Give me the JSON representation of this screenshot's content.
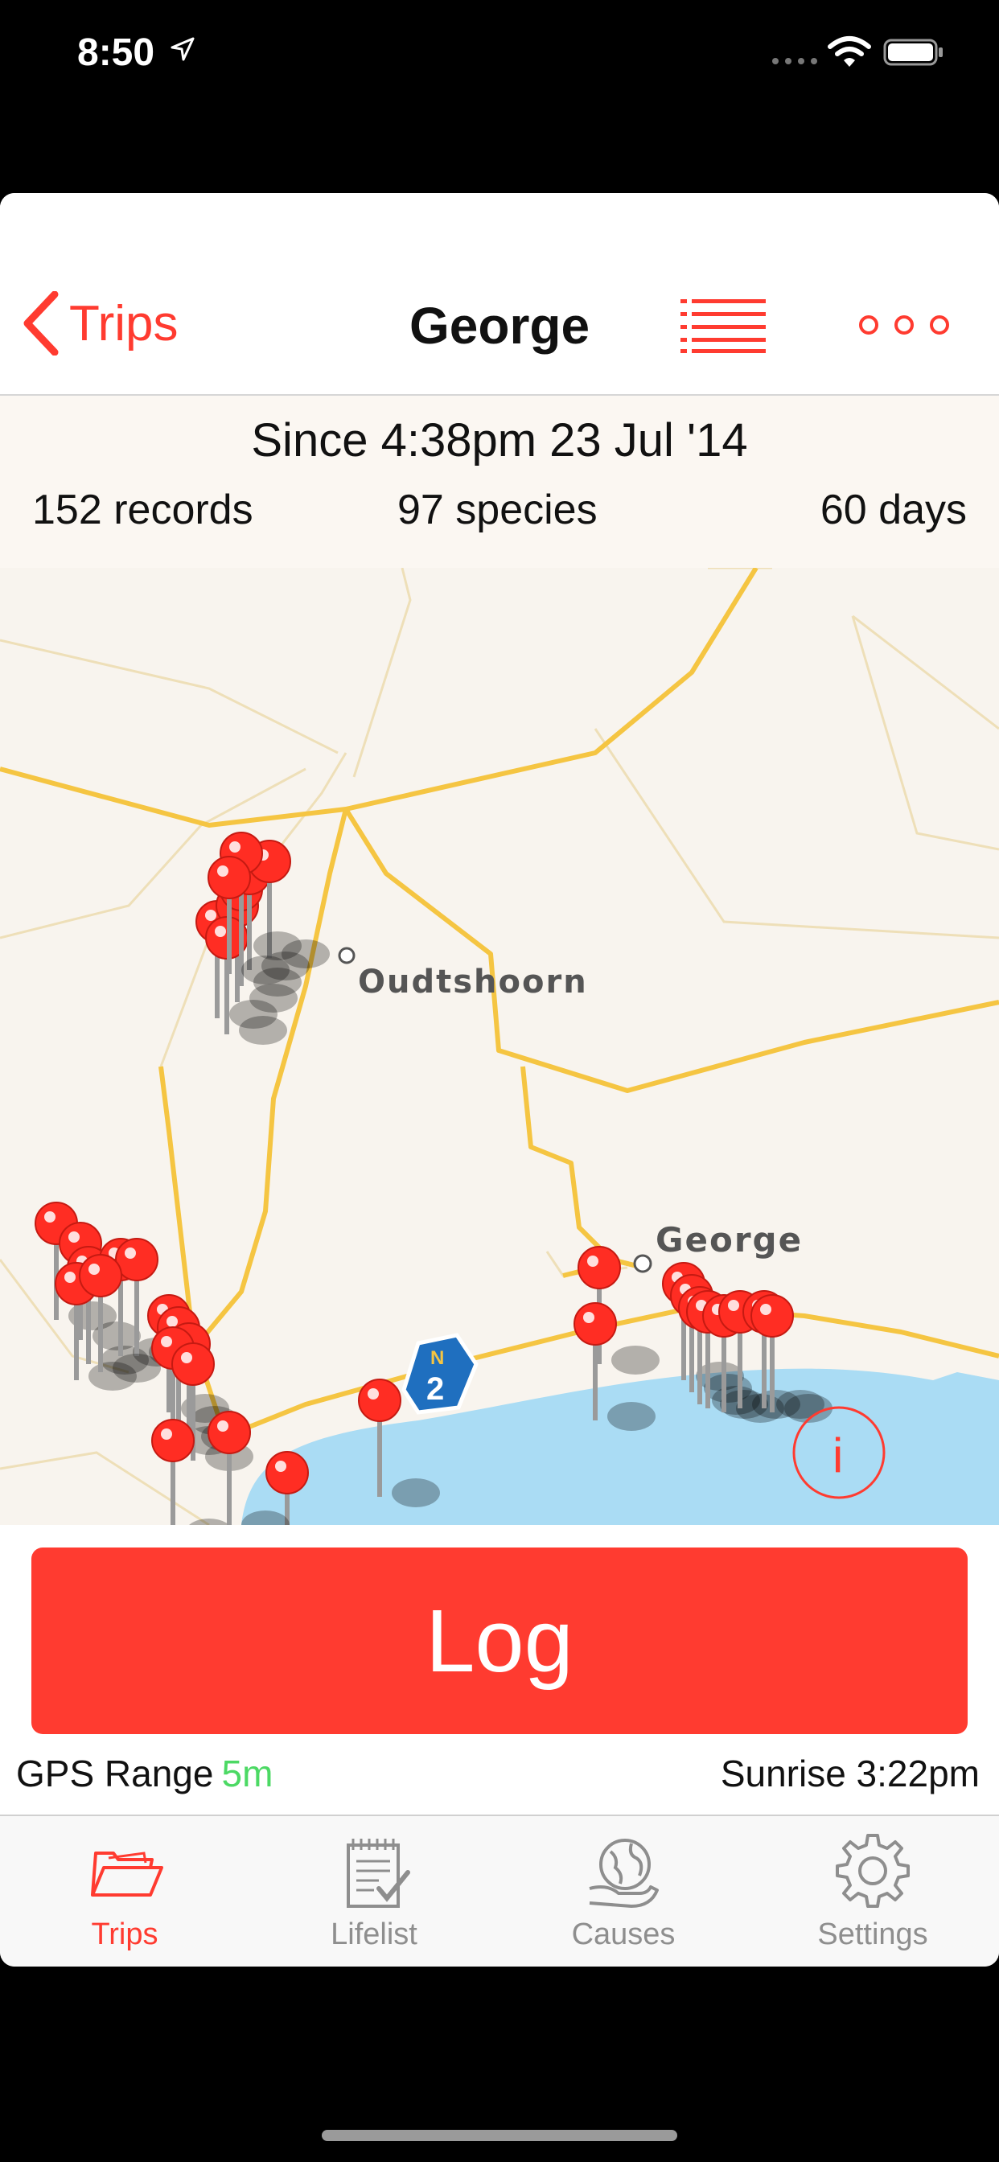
{
  "status_bar": {
    "time": "8:50"
  },
  "nav": {
    "back_label": "Trips",
    "title": "George"
  },
  "trip_stats": {
    "since": "Since 4:38pm 23 Jul '14",
    "records": "152 records",
    "species": "97 species",
    "days": "60 days"
  },
  "map": {
    "place_labels": [
      "Oudtshoorn",
      "George"
    ],
    "route_shield": {
      "letter": "N",
      "number": "2"
    },
    "info_button": "i",
    "colors": {
      "land": "#f8f4ee",
      "water": "#aadcf4",
      "road": "#f5c542",
      "pin": "#ff2d23"
    }
  },
  "log": {
    "button_label": "Log",
    "gps_label": "GPS Range",
    "gps_value": "5m",
    "sunrise": "Sunrise 3:22pm"
  },
  "tabs": [
    {
      "label": "Trips",
      "icon": "folder-icon",
      "active": true
    },
    {
      "label": "Lifelist",
      "icon": "checklist-icon",
      "active": false
    },
    {
      "label": "Causes",
      "icon": "globe-hand-icon",
      "active": false
    },
    {
      "label": "Settings",
      "icon": "gear-icon",
      "active": false
    }
  ],
  "accent_color": "#ff3b30"
}
